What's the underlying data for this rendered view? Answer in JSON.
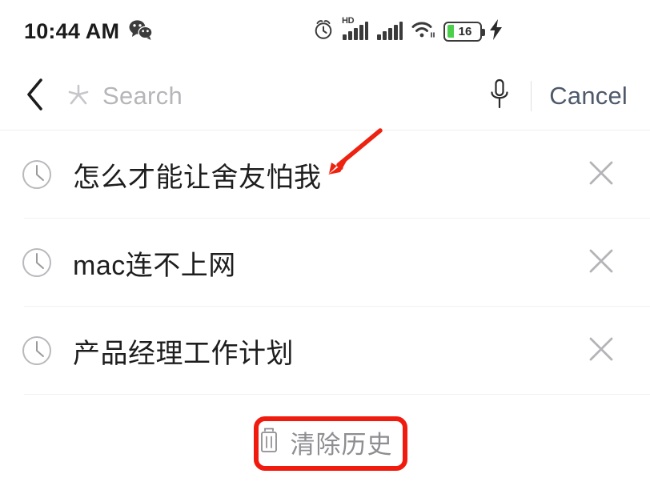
{
  "status_bar": {
    "time": "10:44 AM",
    "app_icon": "wechat-icon",
    "icons": [
      "alarm-clock-icon",
      "hd-signal-icon",
      "signal-icon",
      "wifi-icon",
      "battery-icon",
      "charging-bolt-icon"
    ],
    "hd_label": "HD",
    "battery_level": "16",
    "battery_fill_color": "#4cd04c",
    "charging": true
  },
  "search_bar": {
    "back_icon": "back-chevron-icon",
    "search_icon": "search-starburst-icon",
    "placeholder": "Search",
    "value": "",
    "mic_icon": "microphone-icon",
    "cancel_label": "Cancel",
    "cancel_color": "#4e5a6b"
  },
  "history": {
    "row_icon": "clock-icon",
    "delete_icon": "close-x-icon",
    "items": [
      {
        "text": "怎么才能让舍友怕我"
      },
      {
        "text": "mac连不上网"
      },
      {
        "text": "产品经理工作计划"
      }
    ]
  },
  "clear_history": {
    "icon": "trash-icon",
    "label": "清除历史"
  },
  "annotations": {
    "highlight_color": "#f01b0e",
    "box_target": "clear-history-button",
    "arrow_target": "history-item-0"
  }
}
